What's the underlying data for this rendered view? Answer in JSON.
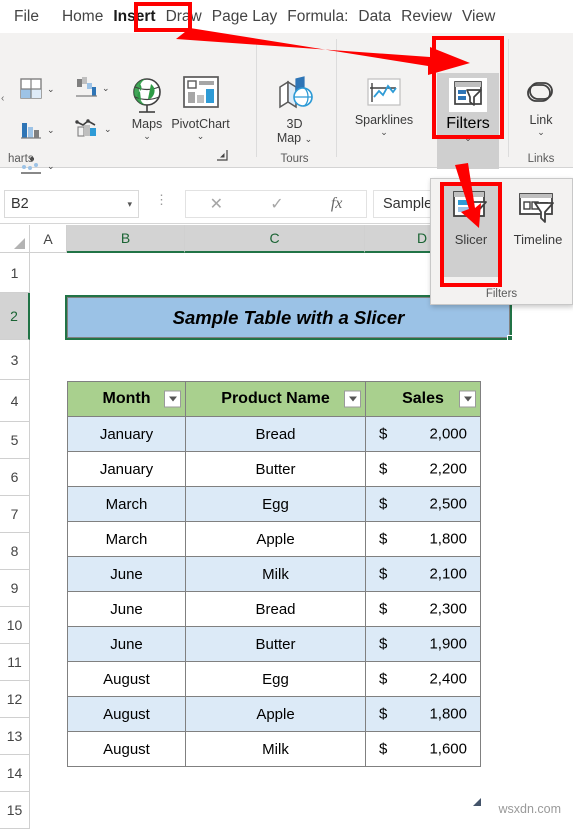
{
  "ribbon": {
    "tabs": [
      {
        "label": "File",
        "active": false
      },
      {
        "label": "Home",
        "active": false
      },
      {
        "label": "Insert",
        "active": true
      },
      {
        "label": "Draw",
        "active": false
      },
      {
        "label": "Page Lay",
        "active": false
      },
      {
        "label": "Formula:",
        "active": false
      },
      {
        "label": "Data",
        "active": false
      },
      {
        "label": "Review",
        "active": false
      },
      {
        "label": "View",
        "active": false
      }
    ],
    "groups": [
      {
        "label": "harts"
      },
      {
        "label": "Tours"
      },
      {
        "label": "Links"
      }
    ],
    "buttons": {
      "maps": "Maps",
      "pivotchart": "PivotChart",
      "map3d_line1": "3D",
      "map3d_line2": "Map",
      "sparklines": "Sparklines",
      "filters": "Filters",
      "link": "Link"
    },
    "chevron": "⌄"
  },
  "dropdown": {
    "slicer": "Slicer",
    "timeline": "Timeline",
    "group_label": "Filters"
  },
  "formula_bar": {
    "namebox_value": "B2",
    "cancel_icon": "✕",
    "confirm_icon": "✓",
    "fx_icon": "fx",
    "cell_content": "Sample Table with a Slicer"
  },
  "grid": {
    "columns": [
      {
        "label": "A",
        "selected": false
      },
      {
        "label": "B",
        "selected": true
      },
      {
        "label": "C",
        "selected": true
      },
      {
        "label": "D",
        "selected": true
      }
    ],
    "rows": [
      "1",
      "2",
      "3",
      "4",
      "5",
      "6",
      "7",
      "8",
      "9",
      "10",
      "11",
      "12",
      "13",
      "14",
      "15"
    ],
    "active_row": "2",
    "title_cell": "Sample Table with a Slicer"
  },
  "table": {
    "headers": [
      "Month",
      "Product Name",
      "Sales"
    ],
    "currency_symbol": "$",
    "rows": [
      {
        "month": "January",
        "product": "Bread",
        "sales": "2,000"
      },
      {
        "month": "January",
        "product": "Butter",
        "sales": "2,200"
      },
      {
        "month": "March",
        "product": "Egg",
        "sales": "2,500"
      },
      {
        "month": "March",
        "product": "Apple",
        "sales": "1,800"
      },
      {
        "month": "June",
        "product": "Milk",
        "sales": "2,100"
      },
      {
        "month": "June",
        "product": "Bread",
        "sales": "2,300"
      },
      {
        "month": "June",
        "product": "Butter",
        "sales": "1,900"
      },
      {
        "month": "August",
        "product": "Egg",
        "sales": "2,400"
      },
      {
        "month": "August",
        "product": "Apple",
        "sales": "1,800"
      },
      {
        "month": "August",
        "product": "Milk",
        "sales": "1,600"
      }
    ]
  },
  "annotations": {
    "highlight_color": "#fe0000"
  },
  "colors": {
    "header_green": "#a9d08e",
    "alt_row_blue": "#dceaf7",
    "title_blue": "#9bc2e6",
    "excel_green": "#217346"
  },
  "watermark": "wsxdn.com"
}
